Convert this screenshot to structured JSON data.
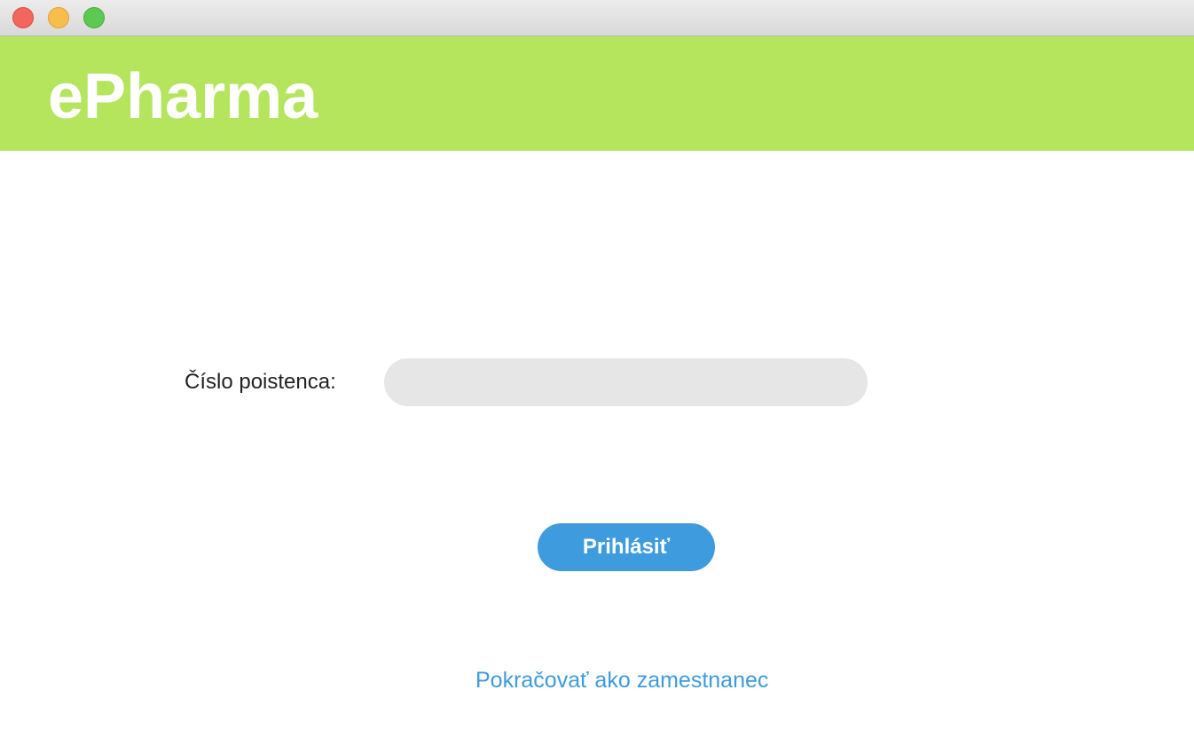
{
  "window": {
    "controls": {
      "close": "close-icon",
      "minimize": "minimize-icon",
      "maximize": "maximize-icon"
    }
  },
  "header": {
    "title": "ePharma",
    "background_color": "#b5e45d"
  },
  "form": {
    "insured_label": "Číslo poistenca:",
    "insured_value": "",
    "insured_placeholder": ""
  },
  "actions": {
    "login_label": "Prihlásiť",
    "employee_link_label": "Pokračovať ako zamestnanec",
    "accent_color": "#3e9bdd"
  }
}
